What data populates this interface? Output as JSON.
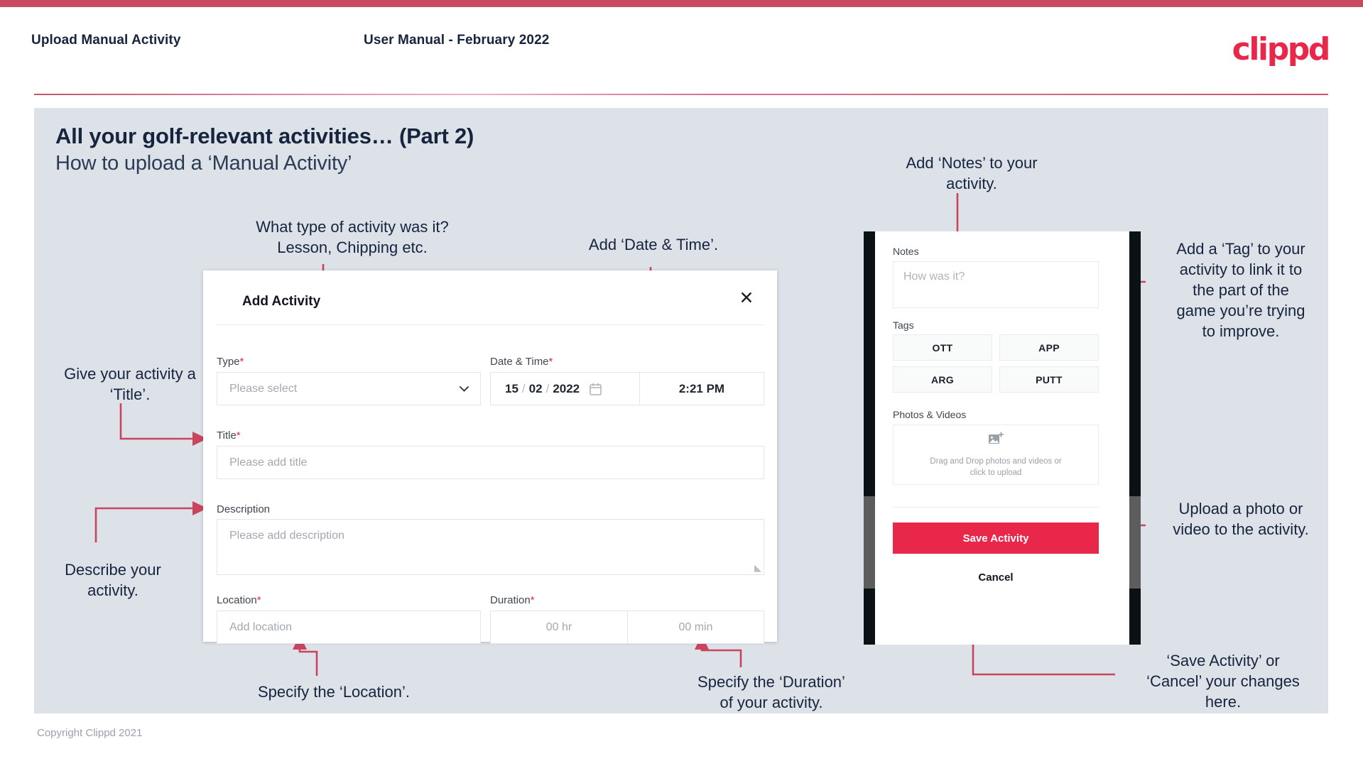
{
  "header": {
    "left_title": "Upload Manual Activity",
    "center_title": "User Manual - February 2022",
    "logo": "clippd"
  },
  "slide": {
    "title_main": "All your golf-relevant activities… (Part 2)",
    "title_sub": "How to upload a ‘Manual Activity’",
    "footer": "Copyright Clippd 2021"
  },
  "annotations": {
    "type": "What type of activity was it?\nLesson, Chipping etc.",
    "datetime": "Add ‘Date & Time’.",
    "title": "Give your activity a\n‘Title’.",
    "description": "Describe your\nactivity.",
    "location": "Specify the ‘Location’.",
    "duration": "Specify the ‘Duration’\nof your activity.",
    "notes": "Add ‘Notes’ to your\nactivity.",
    "tags": "Add a ‘Tag’ to your\nactivity to link it to\nthe part of the\ngame you’re trying\nto improve.",
    "photos": "Upload a photo or\nvideo to the activity.",
    "save": "‘Save Activity’ or\n‘Cancel’ your changes\nhere."
  },
  "dialog": {
    "title": "Add Activity",
    "close_icon": "✕",
    "type": {
      "label": "Type",
      "required": "*",
      "placeholder": "Please select"
    },
    "datetime": {
      "label": "Date & Time",
      "required": "*",
      "day": "15",
      "month": "02",
      "year": "2022",
      "sep": "/",
      "time": "2:21 PM"
    },
    "title_field": {
      "label": "Title",
      "required": "*",
      "placeholder": "Please add title"
    },
    "description": {
      "label": "Description",
      "placeholder": "Please add description"
    },
    "location": {
      "label": "Location",
      "required": "*",
      "placeholder": "Add location"
    },
    "duration": {
      "label": "Duration",
      "required": "*",
      "hours": "00 hr",
      "minutes": "00 min"
    }
  },
  "phone": {
    "notes": {
      "label": "Notes",
      "placeholder": "How was it?"
    },
    "tags": {
      "label": "Tags",
      "items": [
        "OTT",
        "APP",
        "ARG",
        "PUTT"
      ]
    },
    "photos": {
      "label": "Photos & Videos",
      "drop_line1": "Drag and Drop photos and videos or",
      "drop_line2": "click to upload"
    },
    "save_label": "Save Activity",
    "cancel_label": "Cancel"
  },
  "colors": {
    "accent": "#e8274b",
    "top_bar": "#c94a61",
    "slide_bg": "#dde2e9",
    "arrow": "#c9455e",
    "text_dark": "#16243d"
  }
}
